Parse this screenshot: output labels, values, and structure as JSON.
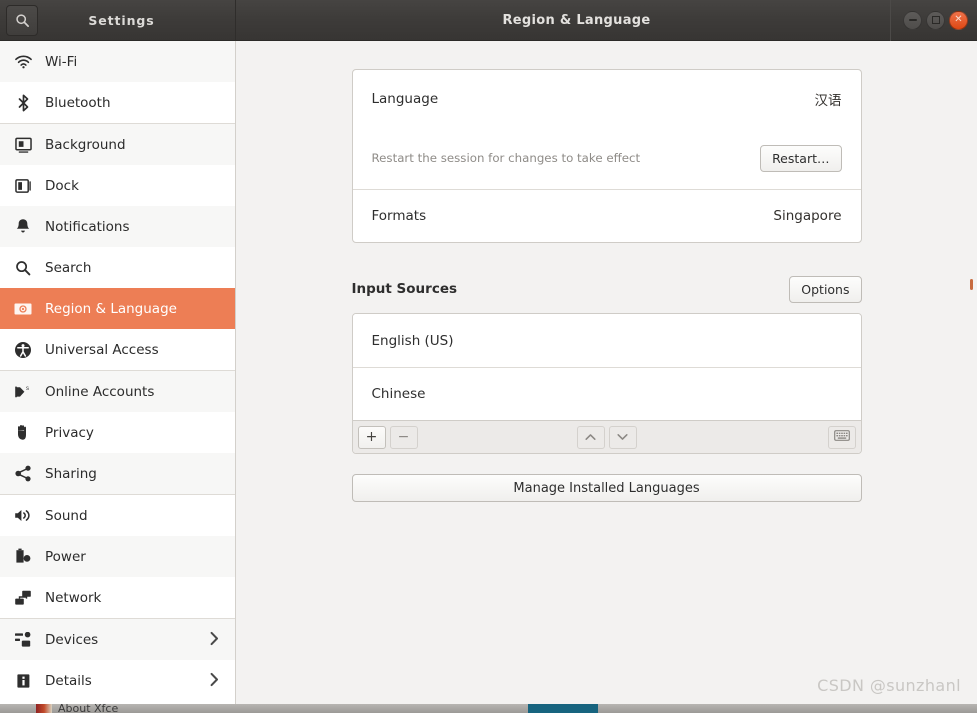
{
  "titlebar": {
    "search_icon": "search-icon",
    "settings_label": "Settings",
    "window_title": "Region & Language",
    "minimize_label": "–",
    "maximize_label": "□",
    "close_label": "×"
  },
  "sidebar": {
    "items": [
      {
        "label": "Wi-Fi",
        "icon": "wifi-icon",
        "chevron": ""
      },
      {
        "label": "Bluetooth",
        "icon": "bluetooth-icon",
        "chevron": ""
      },
      {
        "label": "Background",
        "icon": "background-icon",
        "chevron": ""
      },
      {
        "label": "Dock",
        "icon": "dock-icon",
        "chevron": ""
      },
      {
        "label": "Notifications",
        "icon": "bell-icon",
        "chevron": ""
      },
      {
        "label": "Search",
        "icon": "search-icon",
        "chevron": ""
      },
      {
        "label": "Region & Language",
        "icon": "flag-icon",
        "chevron": ""
      },
      {
        "label": "Universal Access",
        "icon": "accessibility-icon",
        "chevron": ""
      },
      {
        "label": "Online Accounts",
        "icon": "online-accounts-icon",
        "chevron": ""
      },
      {
        "label": "Privacy",
        "icon": "hand-icon",
        "chevron": ""
      },
      {
        "label": "Sharing",
        "icon": "share-icon",
        "chevron": ""
      },
      {
        "label": "Sound",
        "icon": "speaker-icon",
        "chevron": ""
      },
      {
        "label": "Power",
        "icon": "battery-icon",
        "chevron": ""
      },
      {
        "label": "Network",
        "icon": "network-icon",
        "chevron": ""
      },
      {
        "label": "Devices",
        "icon": "devices-icon",
        "chevron": "›"
      },
      {
        "label": "Details",
        "icon": "info-icon",
        "chevron": "›"
      }
    ],
    "selected_index": 6,
    "selected_color": "#ed7e55"
  },
  "main": {
    "language_card": {
      "language_label": "Language",
      "language_value": "汉语",
      "restart_note": "Restart the session for changes to take effect",
      "restart_button": "Restart…",
      "formats_label": "Formats",
      "formats_value": "Singapore"
    },
    "input_sources": {
      "section_title": "Input Sources",
      "options_button": "Options",
      "sources": [
        {
          "label": "English (US)"
        },
        {
          "label": "Chinese"
        }
      ],
      "toolbar": {
        "add_label": "+",
        "remove_label": "−",
        "move_up_label": "∧",
        "move_down_label": "∨",
        "keyboard_label": "keyboard-icon"
      }
    },
    "manage_button": "Manage Installed Languages"
  },
  "overlay": {
    "watermark": "CSDN @sunzhanl"
  },
  "taskbar": {
    "app_label": "About Xfce"
  }
}
